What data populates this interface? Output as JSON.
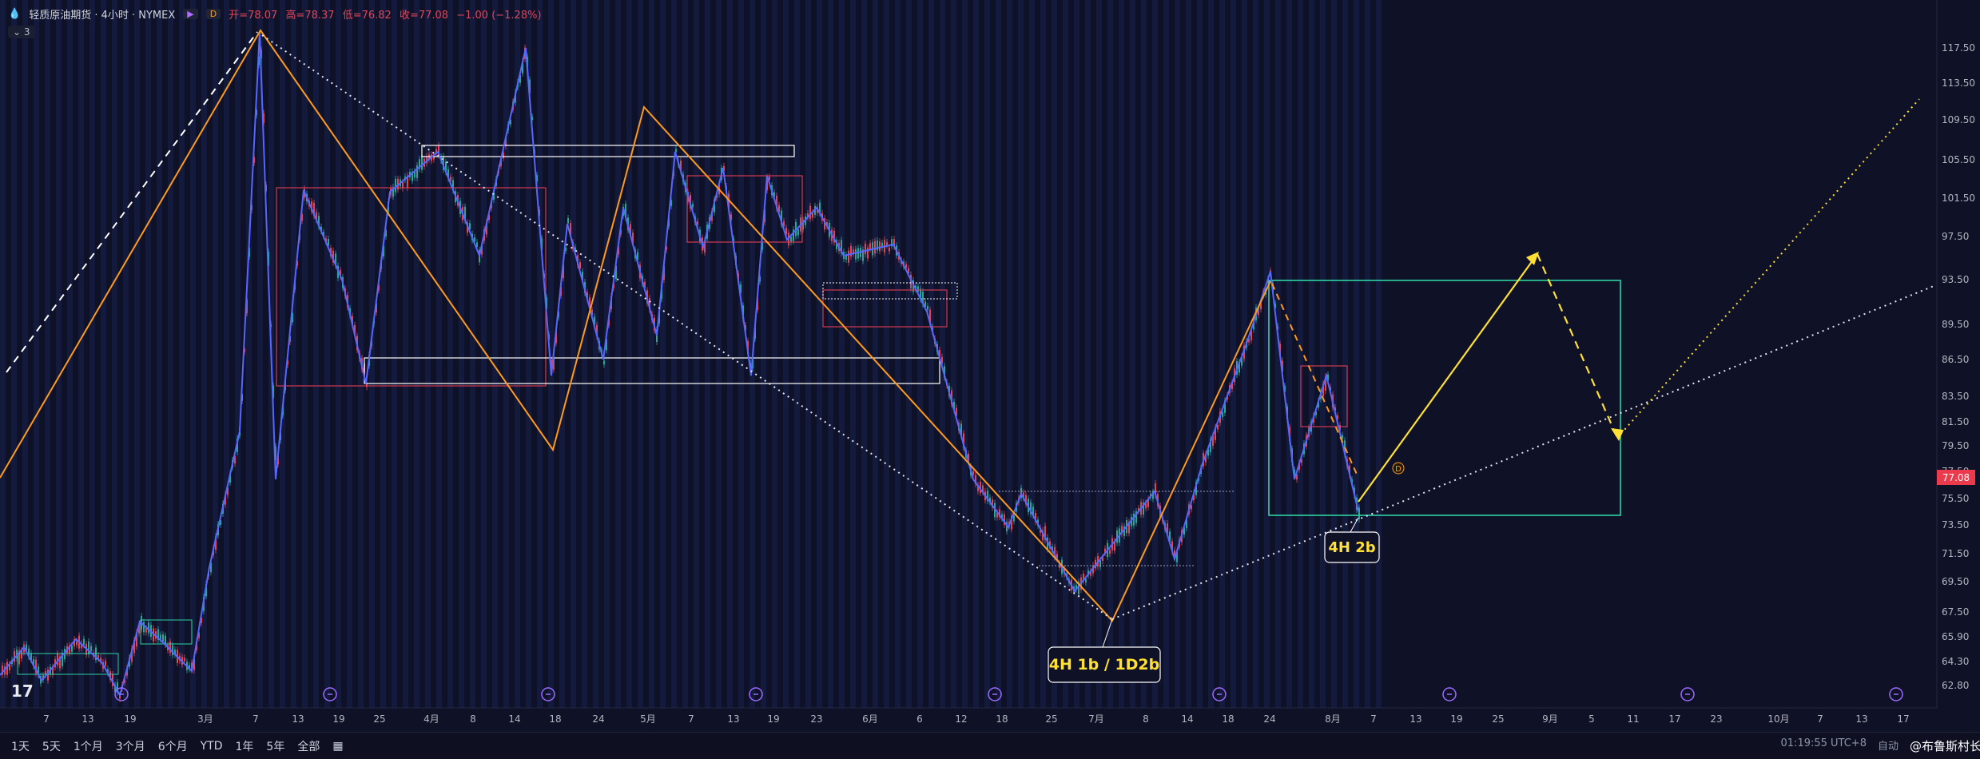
{
  "header": {
    "title": "轻质原油期货 · 4小时 · NYMEX",
    "badge": "D",
    "open": "开=78.07",
    "high": "高=78.37",
    "low": "低=76.82",
    "close": "收=77.08",
    "change": "−1.00 (−1.28%)",
    "indicator_chip": "3"
  },
  "colors": {
    "background": "#0f1126",
    "orange_line": "#ff9b1a",
    "blue_line": "#5667ff",
    "box_red": "#d23a52",
    "box_white": "#ffffff",
    "box_green": "#2dd4a3",
    "yellow_projection": "#ffe033",
    "dotted": "#e6e6ee",
    "candle_up": "#2aa59a",
    "candle_down": "#e0465a",
    "price_tag": "#ea3a4c"
  },
  "chart_data": {
    "type": "line",
    "price_levels": [
      "117.50",
      "113.50",
      "109.50",
      "105.50",
      "101.50",
      "97.50",
      "93.50",
      "89.50",
      "86.50",
      "83.50",
      "81.50",
      "79.50",
      "77.50",
      "75.50",
      "73.50",
      "71.50",
      "69.50",
      "67.50",
      "65.90",
      "64.30",
      "62.80"
    ],
    "current_price": "77.08",
    "time_labels": [
      "7",
      "13",
      "19",
      "3月",
      "7",
      "13",
      "19",
      "25",
      "4月",
      "8",
      "14",
      "18",
      "24",
      "5月",
      "7",
      "13",
      "19",
      "23",
      "6月",
      "6",
      "12",
      "18",
      "25",
      "7月",
      "8",
      "14",
      "18",
      "24",
      "8月",
      "7",
      "13",
      "19",
      "25",
      "9月",
      "5",
      "11",
      "17",
      "23",
      "10月",
      "7",
      "13",
      "17"
    ],
    "annotations": [
      "4H 1b / 1D2b",
      "4H 2b"
    ],
    "series": []
  },
  "bottom_bar": {
    "ranges": [
      "1天",
      "5天",
      "1个月",
      "3个月",
      "6个月",
      "YTD",
      "1年",
      "5年",
      "全部"
    ],
    "clock": "01:19:55 UTC+8",
    "modes": [
      "自动"
    ]
  },
  "watermark": "@布鲁斯村长"
}
